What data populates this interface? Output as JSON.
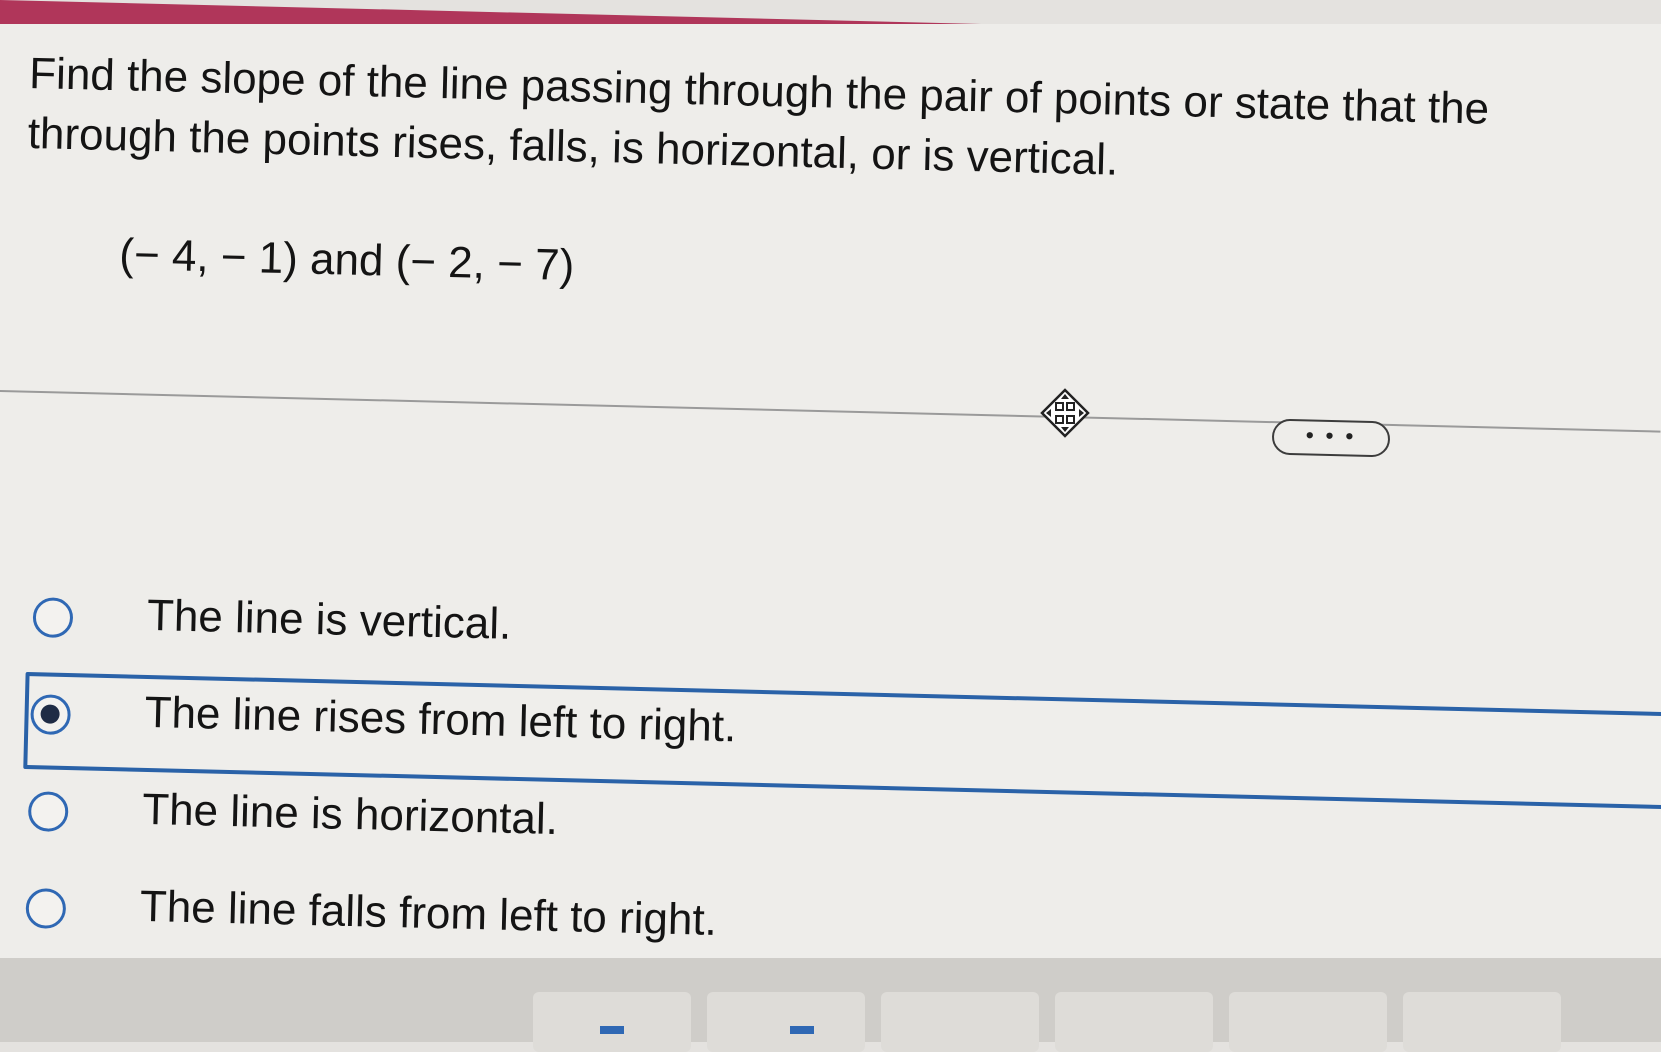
{
  "question": {
    "prompt": "Find the slope of the line passing through the pair of points or state that the\nthrough the points rises, falls, is horizontal, or is vertical.",
    "points": "(− 4, − 1) and (− 2, − 7)"
  },
  "toolbar": {
    "more_label": "• • •"
  },
  "options": [
    {
      "label": "The line is vertical.",
      "selected": false
    },
    {
      "label": "The line rises from left to right.",
      "selected": true
    },
    {
      "label": "The line is horizontal.",
      "selected": false
    },
    {
      "label": "The line falls from left to right.",
      "selected": false
    }
  ],
  "icons": {
    "move_handle": "move-icon",
    "radio": "radio-button-icon"
  },
  "colors": {
    "banner": "#b0365a",
    "accent": "#2f68b4",
    "selected_border": "#2a62a8",
    "panel": "#eeedea"
  }
}
